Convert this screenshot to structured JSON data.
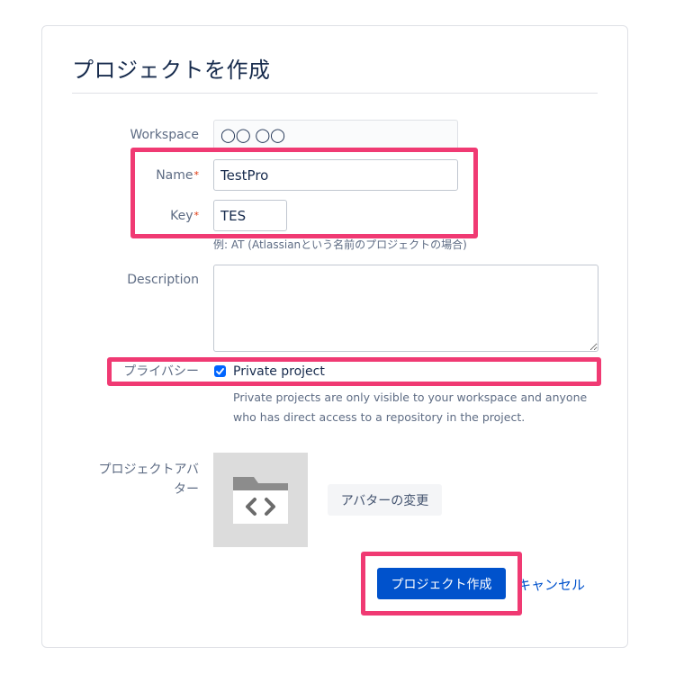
{
  "page": {
    "title": "プロジェクトを作成"
  },
  "form": {
    "workspace": {
      "label": "Workspace",
      "value": "◯◯ ◯◯"
    },
    "name": {
      "label": "Name",
      "required_mark": "*",
      "value": "TestPro"
    },
    "key": {
      "label": "Key",
      "required_mark": "*",
      "value": "TES",
      "help": "例: AT (Atlassianという名前のプロジェクトの場合)"
    },
    "description": {
      "label": "Description",
      "value": ""
    },
    "privacy": {
      "label": "プライバシー",
      "checkbox_label": "Private project",
      "checked": true,
      "help_line1": "Private projects are only visible to your workspace and anyone",
      "help_line2": "who has direct access to a repository in the project."
    },
    "avatar": {
      "label_line1": "プロジェクトアバ",
      "label_line2": "ター",
      "change_button": "アバターの変更",
      "icon": "folder-code-icon"
    }
  },
  "actions": {
    "submit_label": "プロジェクト作成",
    "cancel_label": "キャンセル"
  },
  "colors": {
    "primary": "#0052cc",
    "highlight": "#f03a73",
    "required": "#de350b"
  }
}
